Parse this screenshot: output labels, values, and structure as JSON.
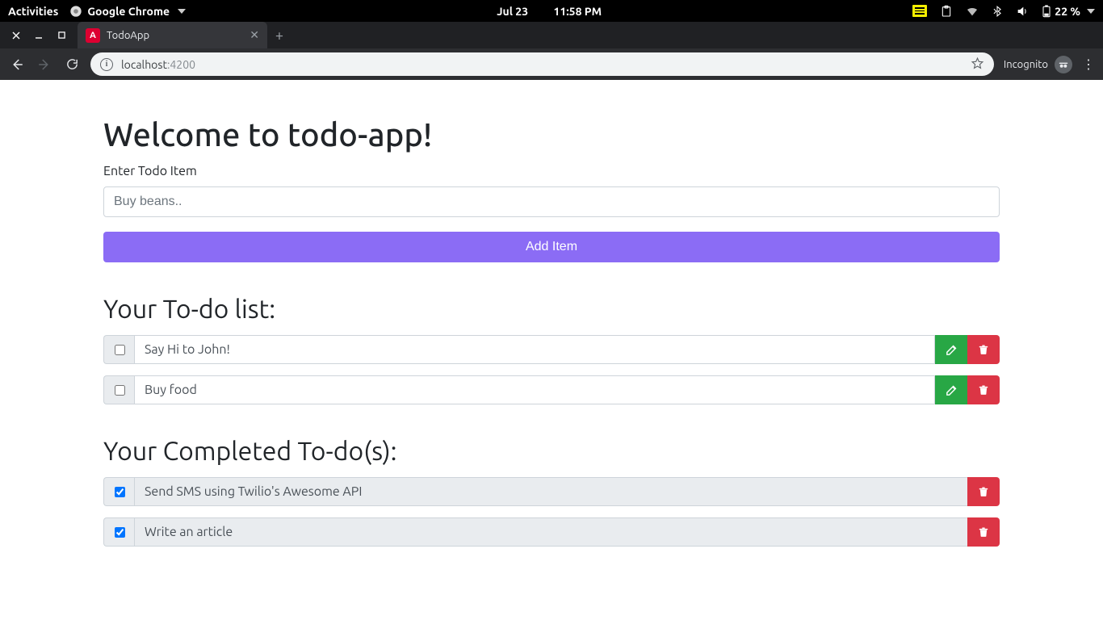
{
  "os": {
    "activities": "Activities",
    "app_name": "Google Chrome",
    "date": "Jul 23",
    "time": "11:58 PM",
    "battery": "22 %"
  },
  "browser": {
    "tab_title": "TodoApp",
    "url_host": "localhost",
    "url_port": ":4200",
    "incognito_label": "Incognito"
  },
  "page": {
    "heading": "Welcome to todo-app!",
    "input_label": "Enter Todo Item",
    "input_placeholder": "Buy beans..",
    "add_button": "Add Item",
    "todo_heading": "Your To-do list:",
    "completed_heading": "Your Completed To-do(s):",
    "todos": [
      {
        "text": "Say Hi to John!",
        "checked": false
      },
      {
        "text": "Buy food",
        "checked": false
      }
    ],
    "completed": [
      {
        "text": "Send SMS using Twilio's Awesome API",
        "checked": true
      },
      {
        "text": "Write an article",
        "checked": true
      }
    ]
  }
}
